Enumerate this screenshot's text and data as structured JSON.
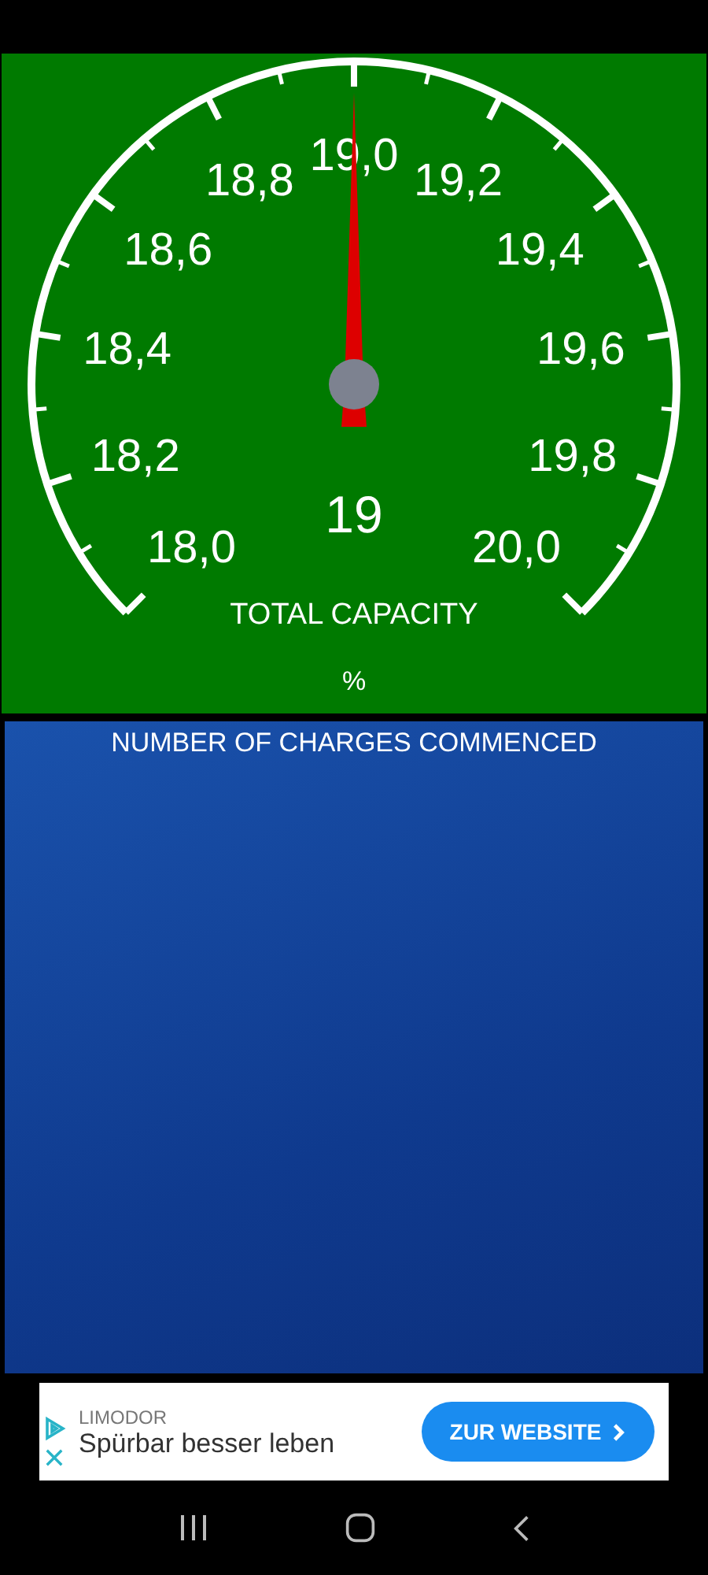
{
  "gauge": {
    "scale_labels": [
      "18,0",
      "18,2",
      "18,4",
      "18,6",
      "18,8",
      "19,0",
      "19,2",
      "19,4",
      "19,6",
      "19,8",
      "20,0"
    ],
    "level": 0.5,
    "reading": "19",
    "title": "TOTAL CAPACITY",
    "unit": "%"
  },
  "charges_panel": {
    "title": "NUMBER OF CHARGES COMMENCED"
  },
  "ad": {
    "advertiser": "LIMODOR",
    "headline": "Spürbar besser leben",
    "button": "ZUR WEBSITE"
  }
}
